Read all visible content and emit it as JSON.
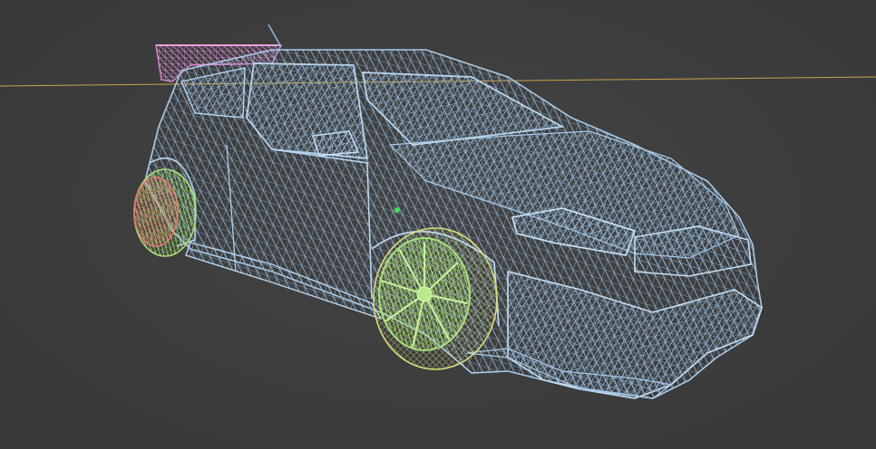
{
  "viewport": {
    "mode": "wireframe",
    "background": "#3d3d3d",
    "x_axis_color": "#c9a24a"
  },
  "object_colors": {
    "body": "#8fb4d8",
    "spoiler": "#d98ad0",
    "wheel_front": "#9fdc6e",
    "tire_front": "#d8de7a",
    "wheel_rear": "#e07a72",
    "tire_rear": "#a9dc78",
    "origin_dot": "#3ee05a"
  },
  "objects": [
    {
      "name": "car-body",
      "icon": "mesh-icon"
    },
    {
      "name": "rear-spoiler",
      "icon": "mesh-icon"
    },
    {
      "name": "front-wheel",
      "icon": "mesh-icon"
    },
    {
      "name": "rear-wheel",
      "icon": "mesh-icon"
    }
  ]
}
